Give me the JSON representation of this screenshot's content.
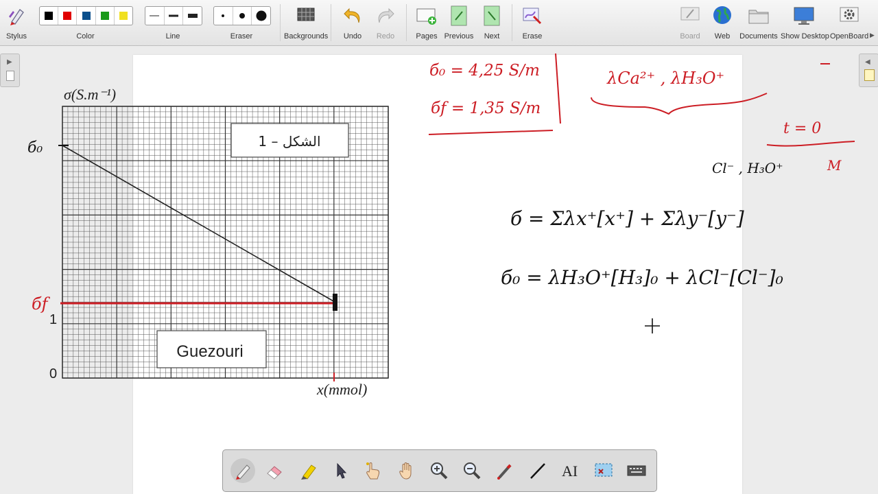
{
  "toolbar": {
    "stylus": "Stylus",
    "color": "Color",
    "line": "Line",
    "eraser": "Eraser",
    "backgrounds": "Backgrounds",
    "undo": "Undo",
    "redo": "Redo",
    "pages": "Pages",
    "previous": "Previous",
    "next": "Next",
    "erase": "Erase",
    "board": "Board",
    "web": "Web",
    "documents": "Documents",
    "show_desktop": "Show Desktop",
    "openboard": "OpenBoard",
    "colors": [
      "#000000",
      "#e00000",
      "#0a4f8c",
      "#1a9a1a",
      "#f0e020"
    ]
  },
  "figure": {
    "y_axis_label": "σ(S.m⁻¹)",
    "x_axis_label": "x(mmol)",
    "tick_zero": "0",
    "tick_one": "1",
    "title_box": "الشكل – 1",
    "author_box": "Guezouri"
  },
  "notes": {
    "sigma0": "б₀",
    "sigmaf": "бf",
    "sigma0_value": "б₀ = 4,25 S/m",
    "sigmaf_value": "бf = 1,35 S/m",
    "ions": "λCa²⁺ , λH₃O⁺",
    "t_zero": "t = 0",
    "cl_h3o": "Cl⁻ , H₃O⁺",
    "eq_general": "б = Σλx⁺[x⁺] + Σλy⁻[y⁻]",
    "eq_initial": "б₀ = λH₃O⁺[H₃]₀ + λCl⁻[Cl⁻]₀"
  },
  "colors": {
    "ink_red": "#cc1d24",
    "ink_black": "#111111",
    "grid": "#333333"
  }
}
